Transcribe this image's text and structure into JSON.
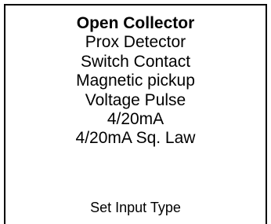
{
  "menu": {
    "items": [
      {
        "label": "Open Collector",
        "selected": true
      },
      {
        "label": "Prox Detector",
        "selected": false
      },
      {
        "label": "Switch Contact",
        "selected": false
      },
      {
        "label": "Magnetic pickup",
        "selected": false
      },
      {
        "label": "Voltage Pulse",
        "selected": false
      },
      {
        "label": "4/20mA",
        "selected": false
      },
      {
        "label": "4/20mA Sq. Law",
        "selected": false
      }
    ]
  },
  "footer": {
    "label": "Set Input Type"
  }
}
